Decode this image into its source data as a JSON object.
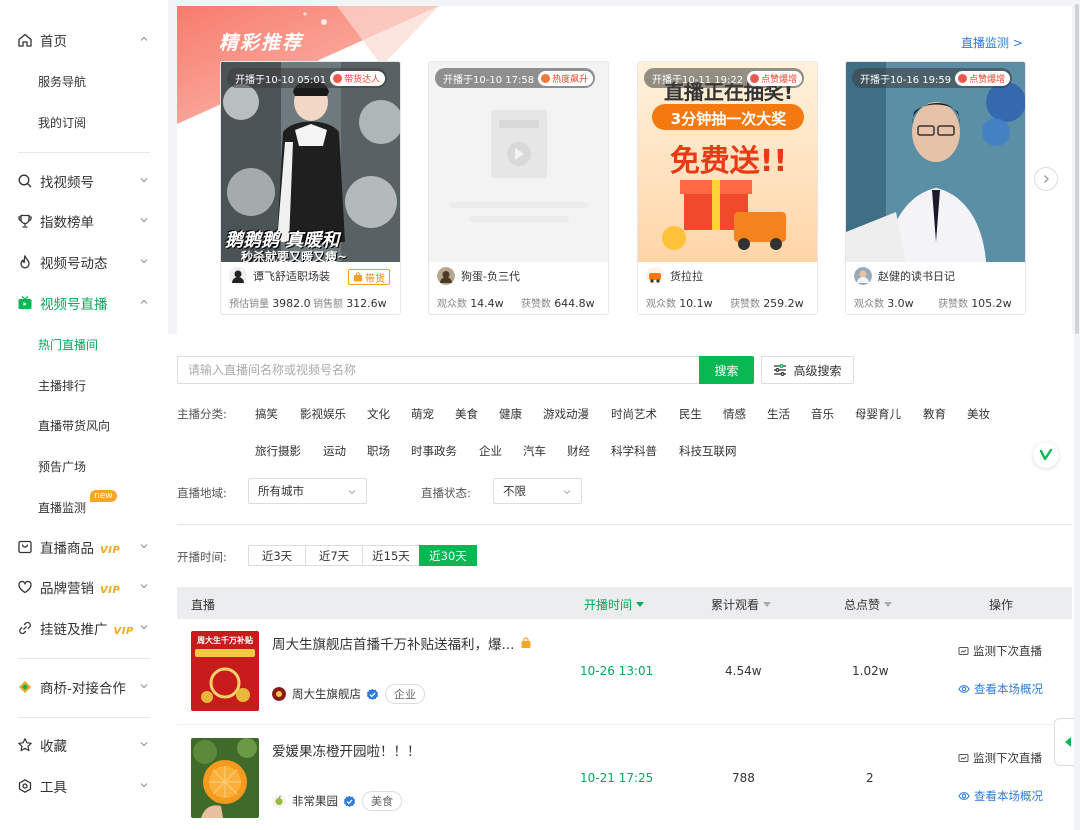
{
  "sidebar": {
    "home": "首页",
    "home_subs": [
      "服务导航",
      "我的订阅"
    ],
    "find": "找视频号",
    "index": "指数榜单",
    "dynamics": "视频号动态",
    "live": "视频号直播",
    "live_subs": [
      "热门直播间",
      "主播排行",
      "直播带货风向",
      "预告广场",
      "直播监测"
    ],
    "new_badge": "new",
    "goods": "直播商品",
    "brand": "品牌营销",
    "link": "挂链及推广",
    "vip": "VIP",
    "bridge": "商桥-对接合作",
    "fav": "收藏",
    "tools": "工具"
  },
  "featured": {
    "title": "精彩推荐",
    "link": "直播监测 >",
    "cards": [
      {
        "time": "开播于10-10 05:01",
        "tag": "带货达人",
        "img_text": [
          "鹅鹅鹅 真暖和",
          "秒杀就要又暖又瘦~"
        ],
        "author": "谭飞舒适职场装",
        "goods": "带货",
        "s1_label": "预估销量",
        "s1": "3982.0",
        "s2_label": "销售额",
        "s2": "312.6w"
      },
      {
        "time": "开播于10-10 17:58",
        "tag": "热度飙升",
        "author": "狗蛋-负三代",
        "s1_label": "观众数",
        "s1": "14.4w",
        "s2_label": "获赞数",
        "s2": "644.8w"
      },
      {
        "time": "开播于10-11 19:22",
        "tag": "点赞爆增",
        "img_text": [
          "直播正在抽奖!",
          "3分钟抽一次大奖",
          "免费送!!"
        ],
        "author": "货拉拉",
        "s1_label": "观众数",
        "s1": "10.1w",
        "s2_label": "获赞数",
        "s2": "259.2w"
      },
      {
        "time": "开播于10-16 19:59",
        "tag": "点赞爆增",
        "author": "赵健的读书日记",
        "s1_label": "观众数",
        "s1": "3.0w",
        "s2_label": "获赞数",
        "s2": "105.2w"
      }
    ]
  },
  "search": {
    "placeholder": "请输入直播间名称或视频号名称",
    "button": "搜索",
    "advanced": "高级搜索"
  },
  "filters": {
    "category_label": "主播分类:",
    "categories_row1": [
      "搞笑",
      "影视娱乐",
      "文化",
      "萌宠",
      "美食",
      "健康",
      "游戏动漫",
      "时尚艺术",
      "民生",
      "情感",
      "生活",
      "音乐",
      "母婴育儿",
      "教育",
      "美妆"
    ],
    "categories_row2": [
      "旅行摄影",
      "运动",
      "职场",
      "时事政务",
      "企业",
      "汽车",
      "财经",
      "科学科普",
      "科技互联网"
    ],
    "region_label": "直播地域:",
    "region_value": "所有城市",
    "status_label": "直播状态:",
    "status_value": "不限",
    "time_label": "开播时间:",
    "time_options": [
      "近3天",
      "近7天",
      "近15天",
      "近30天"
    ]
  },
  "table": {
    "headers": {
      "live": "直播",
      "time": "开播时间",
      "views": "累计观看",
      "likes": "总点赞",
      "ops": "操作"
    },
    "op_monitor": "监测下次直播",
    "op_view": "查看本场概况",
    "rows": [
      {
        "title": "周大生旗舰店首播千万补贴送福利，爆...",
        "shop": "周大生旗舰店",
        "industry": "企业",
        "time": "10-26 13:01",
        "views": "4.54w",
        "likes": "1.02w",
        "thumb_text": "周大生千万补贴"
      },
      {
        "title": "爱媛果冻橙开园啦！！！",
        "shop": "非常果园",
        "industry": "美食",
        "time": "10-21 17:25",
        "views": "788",
        "likes": "2"
      }
    ]
  }
}
